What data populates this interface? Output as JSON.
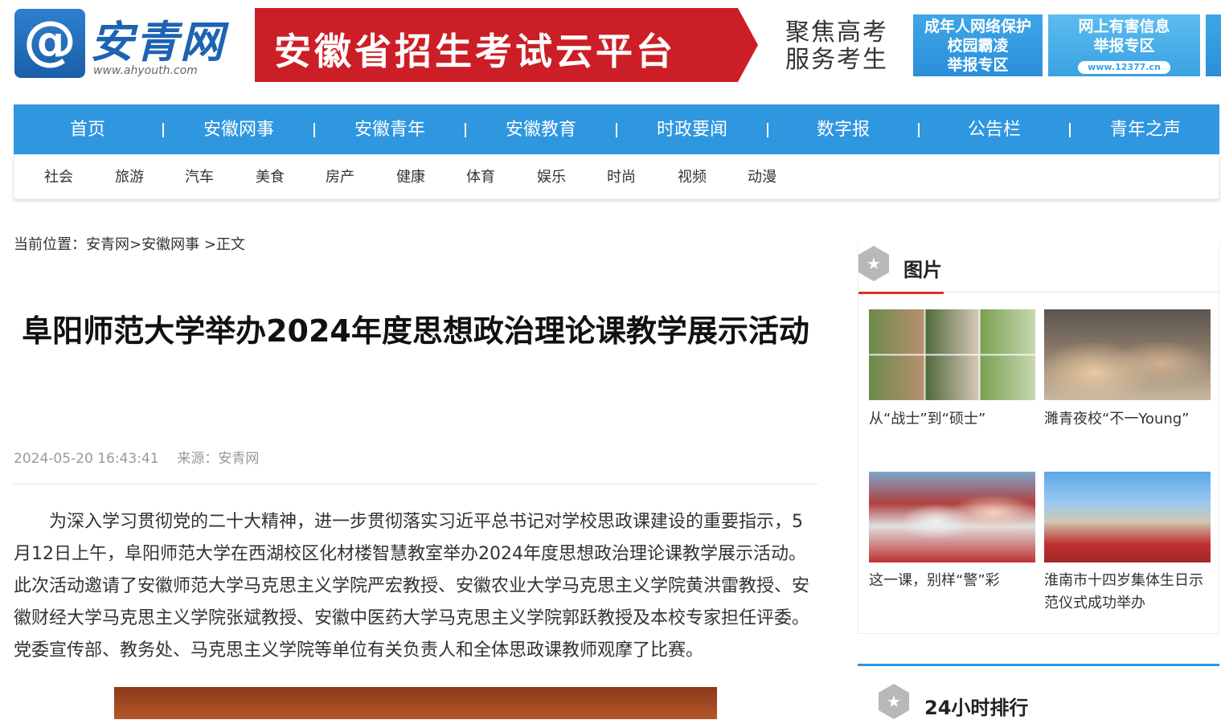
{
  "header": {
    "logo_symbol": "@",
    "logo_text": "安青网",
    "logo_url": "www.ahyouth.com",
    "banner_main": "安徽省招生考试云平台",
    "banner_side_1": "聚焦高考",
    "banner_side_2": "服务考生",
    "promo1_lines": [
      "成年人网络保护",
      "校园霸凌",
      "举报专区"
    ],
    "promo2_lines": [
      "网上有害信息",
      "举报专区"
    ],
    "promo2_pill": "www.12377.cn"
  },
  "nav": {
    "items": [
      "首页",
      "安徽网事",
      "安徽青年",
      "安徽教育",
      "时政要闻",
      "数字报",
      "公告栏",
      "青年之声"
    ]
  },
  "subnav": {
    "items": [
      "社会",
      "旅游",
      "汽车",
      "美食",
      "房产",
      "健康",
      "体育",
      "娱乐",
      "时尚",
      "视频",
      "动漫"
    ]
  },
  "breadcrumb": {
    "prefix": "当前位置：",
    "home": "安青网",
    "section": ">安徽网事",
    "current": " >正文"
  },
  "article": {
    "title": "阜阳师范大学举办2024年度思想政治理论课教学展示活动",
    "date": "2024-05-20 16:43:41",
    "source": "来源：安青网",
    "body": "为深入学习贯彻党的二十大精神，进一步贯彻落实习近平总书记对学校思政课建设的重要指示，5月12日上午，阜阳师范大学在西湖校区化材楼智慧教室举办2024年度思想政治理论课教学展示活动。此次活动邀请了安徽师范大学马克思主义学院严宏教授、安徽农业大学马克思主义学院黄洪雷教授、安徽财经大学马克思主义学院张斌教授、安徽中医药大学马克思主义学院郭跃教授及本校专家担任评委。党委宣传部、教务处、马克思主义学院等单位有关负责人和全体思政课教师观摩了比赛。"
  },
  "sidebar": {
    "pictures_title": "图片",
    "pictures": [
      {
        "caption": "从“战士”到“硕士”"
      },
      {
        "caption": "濉青夜校“不一Young”"
      },
      {
        "caption": "这一课，别样“警”彩"
      },
      {
        "caption": "淮南市十四岁集体生日示范仪式成功举办"
      }
    ],
    "ranking_title": "24小时排行"
  },
  "colors": {
    "nav_blue": "#2f96e0",
    "banner_red": "#cc1e26",
    "accent_red": "#d9322b"
  }
}
